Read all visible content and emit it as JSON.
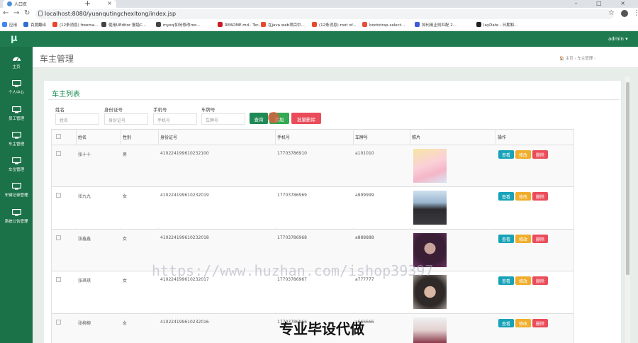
{
  "browser": {
    "tab_title": "人口页",
    "new_tab": "+",
    "window_controls": "–  □  ×",
    "url": "localhost:8080/yuanqutingchexitong/index.jsp",
    "bookmarks": [
      {
        "label": "应用",
        "color": "#4285f4"
      },
      {
        "label": "百度翻译",
        "color": "#2f6fd1"
      },
      {
        "label": "(12条消息) freema...",
        "color": "#e8472e"
      },
      {
        "label": "使用UEditor 报错C...",
        "color": "#444"
      },
      {
        "label": "mysql如何修改roo...",
        "color": "#444"
      },
      {
        "label": "README.md · Ter...",
        "color": "#c71d23"
      },
      {
        "label": "在java web项目中...",
        "color": "#e8472e"
      },
      {
        "label": "(12条消息) root of...",
        "color": "#e8472e"
      },
      {
        "label": "bootstrap-select...",
        "color": "#e94e3c"
      },
      {
        "label": "如何用正则匹配 2...",
        "color": "#3b5bdb"
      },
      {
        "label": "layDate - 日期和...",
        "color": "#222"
      }
    ]
  },
  "app": {
    "logo": "μ",
    "user": "admin ▾",
    "sidebar": [
      {
        "label": "主页",
        "icon": "dashboard-icon"
      },
      {
        "label": "个人中心",
        "icon": "monitor-icon"
      },
      {
        "label": "员工管理",
        "icon": "monitor-icon"
      },
      {
        "label": "车主管理",
        "icon": "monitor-icon"
      },
      {
        "label": "车位管理",
        "icon": "monitor-icon"
      },
      {
        "label": "车辆记录管理",
        "icon": "monitor-icon"
      },
      {
        "label": "系统公告管理",
        "icon": "monitor-icon"
      }
    ],
    "page_title": "车主管理",
    "breadcrumb": "🏠 主页  ›  车主管理  ›",
    "panel_title": "车主列表",
    "filters": [
      {
        "label": "姓名",
        "placeholder": "姓名"
      },
      {
        "label": "身份证号",
        "placeholder": "身份证号"
      },
      {
        "label": "手机号",
        "placeholder": "手机号"
      },
      {
        "label": "车牌号",
        "placeholder": "车牌号"
      }
    ],
    "buttons": {
      "search": "查询",
      "add": "添加",
      "batch_delete": "批量删除"
    },
    "table": {
      "headers": [
        "姓名",
        "性别",
        "身份证号",
        "手机号",
        "车牌号",
        "照片",
        "操作"
      ],
      "rows": [
        {
          "name": "张十十",
          "gender": "男",
          "id": "410224199610232100",
          "phone": "17703786910",
          "plate": "a101010"
        },
        {
          "name": "张九九",
          "gender": "女",
          "id": "410224199610232019",
          "phone": "17703786969",
          "plate": "a999999"
        },
        {
          "name": "张鑫鑫",
          "gender": "女",
          "id": "410224199610232018",
          "phone": "17703786968",
          "plate": "a888888"
        },
        {
          "name": "张琪琪",
          "gender": "女",
          "id": "410224199610232017",
          "phone": "17703786967",
          "plate": "a777777"
        },
        {
          "name": "张柳柳",
          "gender": "女",
          "id": "410224199610232016",
          "phone": "17703786966",
          "plate": "a666666"
        }
      ],
      "actions": {
        "view": "查看",
        "edit": "修改",
        "delete": "删除"
      }
    }
  },
  "watermark": "https://www.huzhan.com/ishop39397",
  "watermark2": "专业毕设代做",
  "colors": {
    "green": "#1b7148",
    "view": "#17a2b8",
    "edit": "#f0ad2b",
    "delete": "#ea4c5a",
    "search": "#1f8a55",
    "add": "#34a853",
    "batch": "#ea4c5a"
  }
}
